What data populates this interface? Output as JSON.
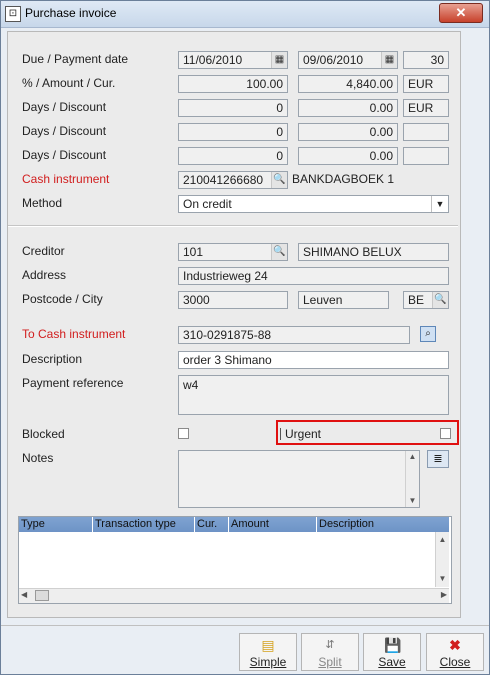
{
  "window": {
    "title": "Purchase invoice",
    "close_glyph": "✕",
    "app_icon": "⊡"
  },
  "rows": {
    "due": {
      "label": "Due / Payment date",
      "date1": "11/06/2010",
      "date2": "09/06/2010",
      "days": "30"
    },
    "amount": {
      "label": "% / Amount / Cur.",
      "pct": "100.00",
      "amount": "4,840.00",
      "cur": "EUR"
    },
    "disc1": {
      "label": "Days / Discount",
      "days": "0",
      "amount": "0.00",
      "cur": "EUR"
    },
    "disc2": {
      "label": "Days / Discount",
      "days": "0",
      "amount": "0.00",
      "cur": ""
    },
    "disc3": {
      "label": "Days / Discount",
      "days": "0",
      "amount": "0.00",
      "cur": ""
    },
    "cash": {
      "label": "Cash instrument",
      "code": "210041266680",
      "name": "BANKDAGBOEK 1"
    },
    "method": {
      "label": "Method",
      "value": "On credit"
    }
  },
  "creditor": {
    "label": "Creditor",
    "code": "101",
    "name": "SHIMANO BELUX",
    "address_label": "Address",
    "address": "Industrieweg 24",
    "postcode_label": "Postcode / City",
    "postcode": "3000",
    "city": "Leuven",
    "country": "BE"
  },
  "payment": {
    "to_cash_label": "To Cash instrument",
    "to_cash": "310-0291875-88",
    "description_label": "Description",
    "description": "order 3 Shimano",
    "reference_label": "Payment reference",
    "reference": "w4",
    "blocked_label": "Blocked",
    "urgent_label": "Urgent",
    "notes_label": "Notes",
    "notes": ""
  },
  "grid": {
    "columns": [
      "Type",
      "Transaction type",
      "Cur.",
      "Amount",
      "Description"
    ]
  },
  "toolbar": {
    "simple": "Simple",
    "split": "Split",
    "save": "Save",
    "close": "Close"
  },
  "colors": {
    "accent_red": "#d11e1e",
    "grid_header": "#7fa3d1",
    "highlight": "#e01010"
  }
}
